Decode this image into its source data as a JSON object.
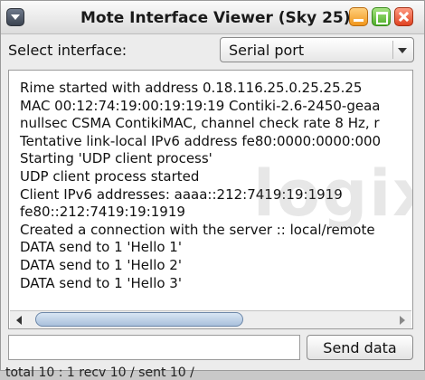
{
  "window": {
    "title": "Mote Interface Viewer (Sky 25)"
  },
  "interface_selector": {
    "label": "Select interface:",
    "selected": "Serial port"
  },
  "log": {
    "lines": [
      "Rime started with address 0.18.116.25.0.25.25.25",
      "MAC 00:12:74:19:00:19:19:19 Contiki-2.6-2450-geaa",
      "nullsec CSMA ContikiMAC, channel check rate 8 Hz, r",
      "Tentative link-local IPv6 address fe80:0000:0000:000",
      "Starting 'UDP client process'",
      "UDP client process started",
      "Client IPv6 addresses: aaaa::212:7419:19:1919",
      "fe80::212:7419:19:1919",
      "Created a connection with the server :: local/remote",
      "DATA send to 1 'Hello 1'",
      "DATA send to 1 'Hello 2'",
      "DATA send to 1 'Hello 3'"
    ],
    "watermark": "logix"
  },
  "send": {
    "input_value": "",
    "button_label": "Send data"
  },
  "background_text": "total 10 : 1 recv 10 / sent 10 /"
}
